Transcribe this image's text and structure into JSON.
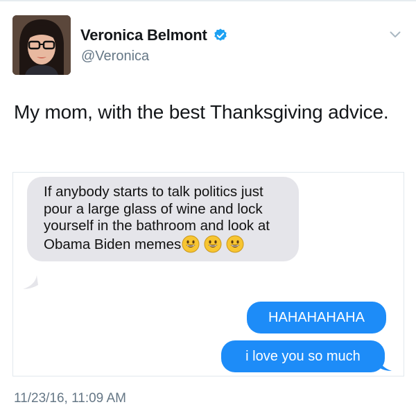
{
  "tweet": {
    "display_name": "Veronica Belmont",
    "handle": "@Veronica",
    "text": "My mom, with the best Thanksgiving advice.",
    "timestamp": "11/23/16, 11:09 AM",
    "icons": {
      "verified": "verified-badge-icon",
      "menu": "chevron-down-icon"
    },
    "colors": {
      "verified": "#1da1f2",
      "muted_text": "#657786"
    }
  },
  "messages": {
    "incoming": {
      "text": "If anybody starts to talk politics just pour a  large glass of wine and lock yourself in the bathroom and look at Obama Biden memes",
      "emoji_count": 3,
      "emoji": "smiley-icon",
      "bubble_color": "#e5e5ea"
    },
    "outgoing": [
      {
        "text": "HAHAHAHAHA"
      },
      {
        "text": "i love you so much"
      }
    ],
    "outgoing_color": "#1d8cf8"
  }
}
